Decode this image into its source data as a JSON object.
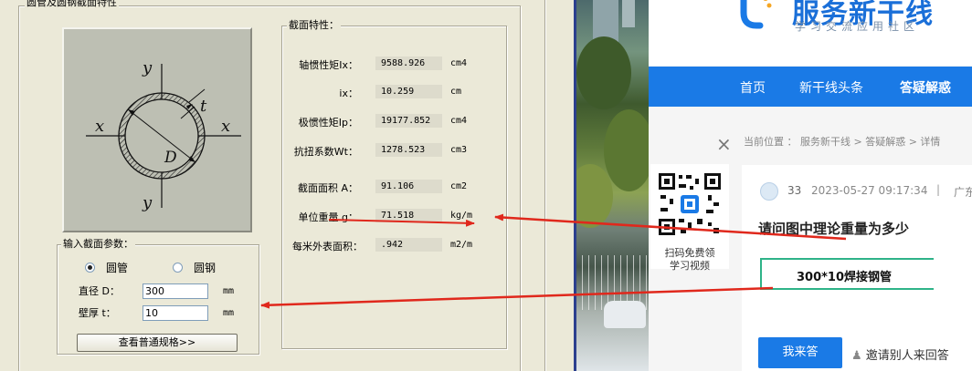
{
  "calc": {
    "outer_title": "圆管及圆钢截面特性",
    "props_title": "截面特性：",
    "properties": [
      {
        "label": "轴惯性矩Ix：",
        "value": "9588.926",
        "unit": "cm4"
      },
      {
        "label": "ix：",
        "value": "10.259",
        "unit": "cm"
      },
      {
        "label": "极惯性矩Ip：",
        "value": "19177.852",
        "unit": "cm4"
      },
      {
        "label": "抗扭系数Wt：",
        "value": "1278.523",
        "unit": "cm3"
      },
      {
        "label": "截面面积 A：",
        "value": "91.106",
        "unit": "cm2"
      },
      {
        "label": "单位重量 g：",
        "value": "71.518",
        "unit": "kg/m"
      },
      {
        "label": "每米外表面积：",
        "value": ".942",
        "unit": "m2/m"
      }
    ],
    "input_title": "输入截面参数：",
    "radio_pipe": "圆管",
    "radio_bar": "圆钢",
    "diameter_label": "直径 D：",
    "diameter_value": "300",
    "diameter_unit": "mm",
    "thickness_label": "壁厚 t：",
    "thickness_value": "10",
    "thickness_unit": "mm",
    "norms_button": "查看普通规格>>",
    "diagram": {
      "y_top": "y",
      "y_bottom": "y",
      "x_left": "x",
      "x_right": "x",
      "t": "t",
      "D": "D"
    }
  },
  "web": {
    "site_name": "服务新干线",
    "slogan": "学习交流应用社区",
    "nav": [
      "首页",
      "新干线头条",
      "答疑解惑"
    ],
    "breadcrumb": "当前位置 ： 服务新干线 > 答疑解惑 > 详情",
    "qr_text_line1": "扫码免费领",
    "qr_text_line2": "学习视频",
    "close_glyph": "×",
    "question": {
      "user": "33",
      "time": "2023-05-27 09:17:34",
      "separator": "|",
      "region": "广东",
      "title": "请问图中理论重量为多少",
      "box_text": "300*10焊接钢管"
    },
    "answer_button": "我来答",
    "invite_text": "邀请别人来回答"
  },
  "colors": {
    "nav_blue": "#1a7ae6",
    "annotation_red": "#e0281c",
    "box_green": "#2eb388",
    "window_face": "#ebe9d8"
  }
}
